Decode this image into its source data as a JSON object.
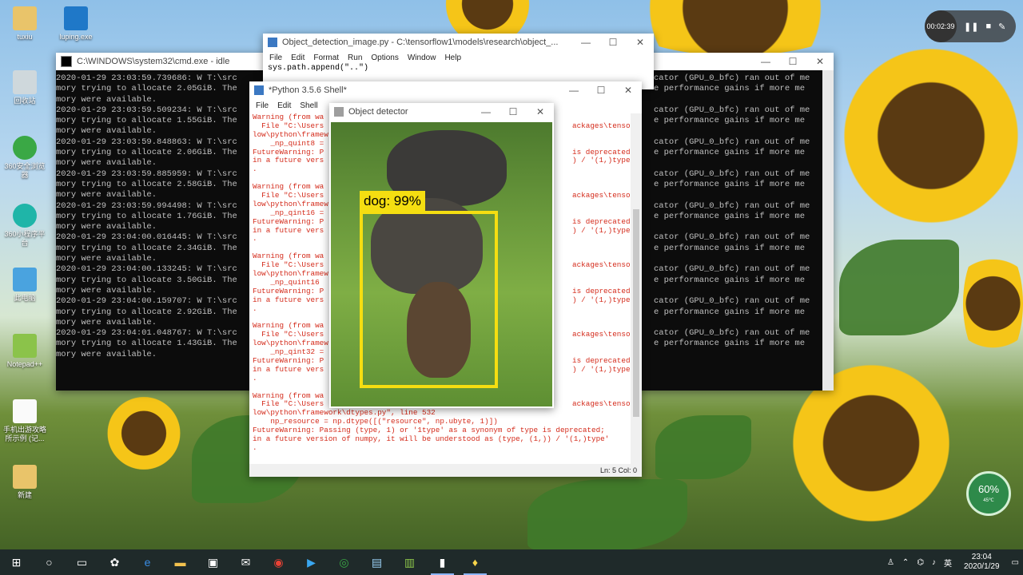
{
  "desktop_icons": [
    {
      "label": "tuxiu",
      "icon": "folder-icon"
    },
    {
      "label": "luping.exe",
      "icon": "app-icon"
    },
    {
      "label": "回收站",
      "icon": "recycle-bin-icon"
    },
    {
      "label": "360安全浏览器",
      "icon": "browser-icon"
    },
    {
      "label": "360小程序平台",
      "icon": "miniapp-icon"
    },
    {
      "label": "此电脑",
      "icon": "computer-icon"
    },
    {
      "label": "Notepad++",
      "icon": "notepad-icon"
    },
    {
      "label": "手机出游攻略所示例 (记...",
      "icon": "document-icon"
    },
    {
      "label": "新建",
      "icon": "folder-icon"
    }
  ],
  "cmd_window": {
    "title": "C:\\WINDOWS\\system32\\cmd.exe - idle",
    "lines": [
      {
        "left": "2020-01-29 23:03:59.739686: W T:\\src",
        "right": "cator (GPU_0_bfc) ran out of me"
      },
      {
        "left": "mory trying to allocate 2.05GiB. The",
        "right": "e performance gains if more me"
      },
      {
        "left": "mory were available.",
        "right": ""
      },
      {
        "left": "2020-01-29 23:03:59.509234: W T:\\src",
        "right": "cator (GPU_0_bfc) ran out of me"
      },
      {
        "left": "mory trying to allocate 1.55GiB. The",
        "right": "e performance gains if more me"
      },
      {
        "left": "mory were available.",
        "right": ""
      },
      {
        "left": "2020-01-29 23:03:59.848863: W T:\\src",
        "right": "cator (GPU_0_bfc) ran out of me"
      },
      {
        "left": "mory trying to allocate 2.06GiB. The",
        "right": "e performance gains if more me"
      },
      {
        "left": "mory were available.",
        "right": ""
      },
      {
        "left": "2020-01-29 23:03:59.885959: W T:\\src",
        "right": "cator (GPU_0_bfc) ran out of me"
      },
      {
        "left": "mory trying to allocate 2.58GiB. The",
        "right": "e performance gains if more me"
      },
      {
        "left": "mory were available.",
        "right": ""
      },
      {
        "left": "2020-01-29 23:03:59.994498: W T:\\src",
        "right": "cator (GPU_0_bfc) ran out of me"
      },
      {
        "left": "mory trying to allocate 1.76GiB. The",
        "right": "e performance gains if more me"
      },
      {
        "left": "mory were available.",
        "right": ""
      },
      {
        "left": "2020-01-29 23:04:00.016445: W T:\\src",
        "right": "cator (GPU_0_bfc) ran out of me"
      },
      {
        "left": "mory trying to allocate 2.34GiB. The",
        "right": "e performance gains if more me"
      },
      {
        "left": "mory were available.",
        "right": ""
      },
      {
        "left": "2020-01-29 23:04:00.133245: W T:\\src",
        "right": "cator (GPU_0_bfc) ran out of me"
      },
      {
        "left": "mory trying to allocate 3.50GiB. The",
        "right": "e performance gains if more me"
      },
      {
        "left": "mory were available.",
        "right": ""
      },
      {
        "left": "2020-01-29 23:04:00.159707: W T:\\src",
        "right": "cator (GPU_0_bfc) ran out of me"
      },
      {
        "left": "mory trying to allocate 2.92GiB. The",
        "right": "e performance gains if more me"
      },
      {
        "left": "mory were available.",
        "right": ""
      },
      {
        "left": "2020-01-29 23:04:01.048767: W T:\\src",
        "right": "cator (GPU_0_bfc) ran out of me"
      },
      {
        "left": "mory trying to allocate 1.43GiB. The",
        "right": "e performance gains if more me"
      },
      {
        "left": "mory were available.",
        "right": ""
      }
    ]
  },
  "idle_window": {
    "title": "Object_detection_image.py - C:\\tensorflow1\\models\\research\\object_...",
    "menu": [
      "File",
      "Edit",
      "Format",
      "Run",
      "Options",
      "Window",
      "Help"
    ],
    "code_line": "sys.path.append(\"..\")"
  },
  "shell_window": {
    "title": "*Python 3.5.6 Shell*",
    "menu": [
      "File",
      "Edit",
      "Shell"
    ],
    "status": "Ln: 5   Col: 0",
    "lines": [
      {
        "l": "Warning (from wa",
        "r": ""
      },
      {
        "l": "  File \"C:\\Users",
        "r": "ackages\\tensorf"
      },
      {
        "l": "low\\python\\framew",
        "r": ""
      },
      {
        "l": "    _np_quint8 =",
        "r": ""
      },
      {
        "l": "FutureWarning: P",
        "r": "is deprecated;"
      },
      {
        "l": "in a future vers",
        "r": ") / '(1,)type'"
      },
      {
        "l": ".",
        "r": ""
      },
      {
        "l": "",
        "r": ""
      },
      {
        "l": "Warning (from wa",
        "r": ""
      },
      {
        "l": "  File \"C:\\Users",
        "r": "ackages\\tensorf"
      },
      {
        "l": "low\\python\\framew",
        "r": ""
      },
      {
        "l": "    _np_qint16 =",
        "r": ""
      },
      {
        "l": "FutureWarning: P",
        "r": "is deprecated;"
      },
      {
        "l": "in a future vers",
        "r": ") / '(1,)type'"
      },
      {
        "l": ".",
        "r": ""
      },
      {
        "l": "",
        "r": ""
      },
      {
        "l": "Warning (from wa",
        "r": ""
      },
      {
        "l": "  File \"C:\\Users",
        "r": "ackages\\tensorf"
      },
      {
        "l": "low\\python\\framew",
        "r": ""
      },
      {
        "l": "    _np_quint16",
        "r": ""
      },
      {
        "l": "FutureWarning: P",
        "r": "is deprecated;"
      },
      {
        "l": "in a future vers",
        "r": ") / '(1,)type'"
      },
      {
        "l": ".",
        "r": ""
      },
      {
        "l": "",
        "r": ""
      },
      {
        "l": "Warning (from wa",
        "r": ""
      },
      {
        "l": "  File \"C:\\Users",
        "r": "ackages\\tensorf"
      },
      {
        "l": "low\\python\\framew",
        "r": ""
      },
      {
        "l": "    _np_qint32 =",
        "r": ""
      },
      {
        "l": "FutureWarning: P",
        "r": "is deprecated;"
      },
      {
        "l": "in a future vers",
        "r": ") / '(1,)type'"
      },
      {
        "l": ".",
        "r": ""
      },
      {
        "l": "",
        "r": ""
      },
      {
        "l": "Warning (from wa",
        "r": ""
      },
      {
        "l": "  File \"C:\\Users",
        "r": "ackages\\tensorf"
      },
      {
        "l": "low\\python\\framework\\dtypes.py\", line 532",
        "r": ""
      },
      {
        "l": "    np_resource = np.dtype([(\"resource\", np.ubyte, 1)])",
        "r": ""
      },
      {
        "l": "FutureWarning: Passing (type, 1) or '1type' as a synonym of type is deprecated;",
        "r": ""
      },
      {
        "l": "in a future version of numpy, it will be understood as (type, (1,)) / '(1,)type'",
        "r": ""
      },
      {
        "l": ".",
        "r": ""
      }
    ]
  },
  "detector_window": {
    "title": "Object detector",
    "detection_label": "dog: 99%",
    "box_color": "#f5de11"
  },
  "recorder": {
    "timer": "00:02:39"
  },
  "gauge": {
    "percent": "60%",
    "temp": "45℃"
  },
  "taskbar": {
    "apps": [
      "start-icon",
      "search-icon",
      "task-view-icon",
      "fan-icon",
      "edge-icon",
      "explorer-icon",
      "store-icon",
      "mail-icon",
      "chrome-icon",
      "luping-icon",
      "browser-360-icon",
      "notepad-icon",
      "python-idle-icon",
      "cmd-icon",
      "python-icon"
    ],
    "time": "23:04",
    "date": "2020/1/29"
  }
}
